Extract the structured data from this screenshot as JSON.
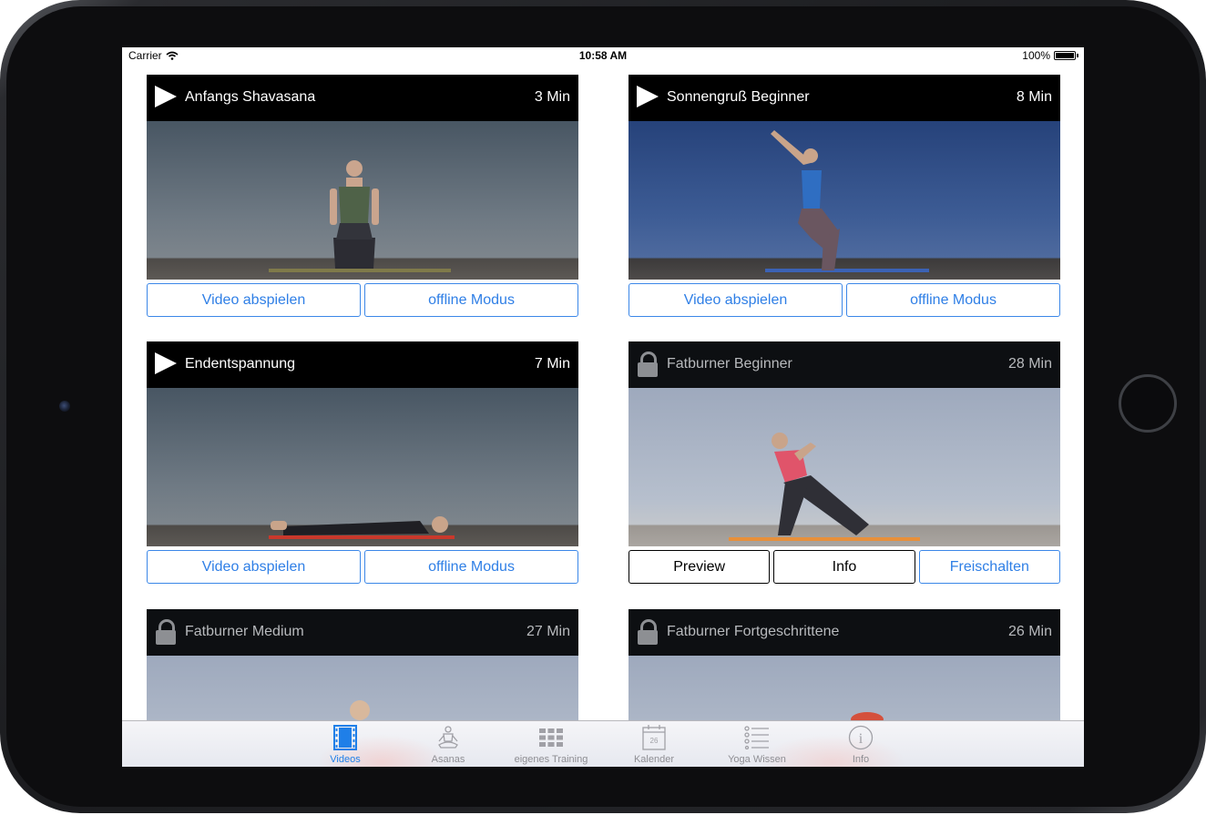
{
  "status_bar": {
    "carrier": "Carrier",
    "time": "10:58 AM",
    "battery": "100%",
    "battery_level": 1.0
  },
  "cards": [
    {
      "title": "Anfangs Shavasana",
      "duration": "3 Min",
      "locked": false,
      "buttons": [
        "Video abspielen",
        "offline Modus"
      ]
    },
    {
      "title": "Sonnengruß Beginner",
      "duration": "8 Min",
      "locked": false,
      "buttons": [
        "Video abspielen",
        "offline Modus"
      ]
    },
    {
      "title": "Endentspannung",
      "duration": "7 Min",
      "locked": false,
      "buttons": [
        "Video abspielen",
        "offline Modus"
      ]
    },
    {
      "title": "Fatburner Beginner",
      "duration": "28 Min",
      "locked": true,
      "buttons": [
        "Preview",
        "Info",
        "Freischalten"
      ]
    },
    {
      "title": "Fatburner Medium",
      "duration": "27 Min",
      "locked": true
    },
    {
      "title": "Fatburner Fortgeschrittene",
      "duration": "26 Min",
      "locked": true
    }
  ],
  "tabbar": {
    "items": [
      {
        "label": "Videos",
        "icon": "film-icon",
        "active": true
      },
      {
        "label": "Asanas",
        "icon": "meditation-icon",
        "active": false
      },
      {
        "label": "eigenes Training",
        "icon": "grid-icon",
        "active": false
      },
      {
        "label": "Kalender",
        "icon": "calendar-icon",
        "active": false,
        "calendar_day": "26"
      },
      {
        "label": "Yoga Wissen",
        "icon": "list-icon",
        "active": false
      },
      {
        "label": "Info",
        "icon": "info-icon",
        "active": false,
        "glyph": "i"
      }
    ]
  },
  "colors": {
    "accent": "#2f7fe6",
    "header_bg": "#000000",
    "locked_text": "#b8babd"
  }
}
